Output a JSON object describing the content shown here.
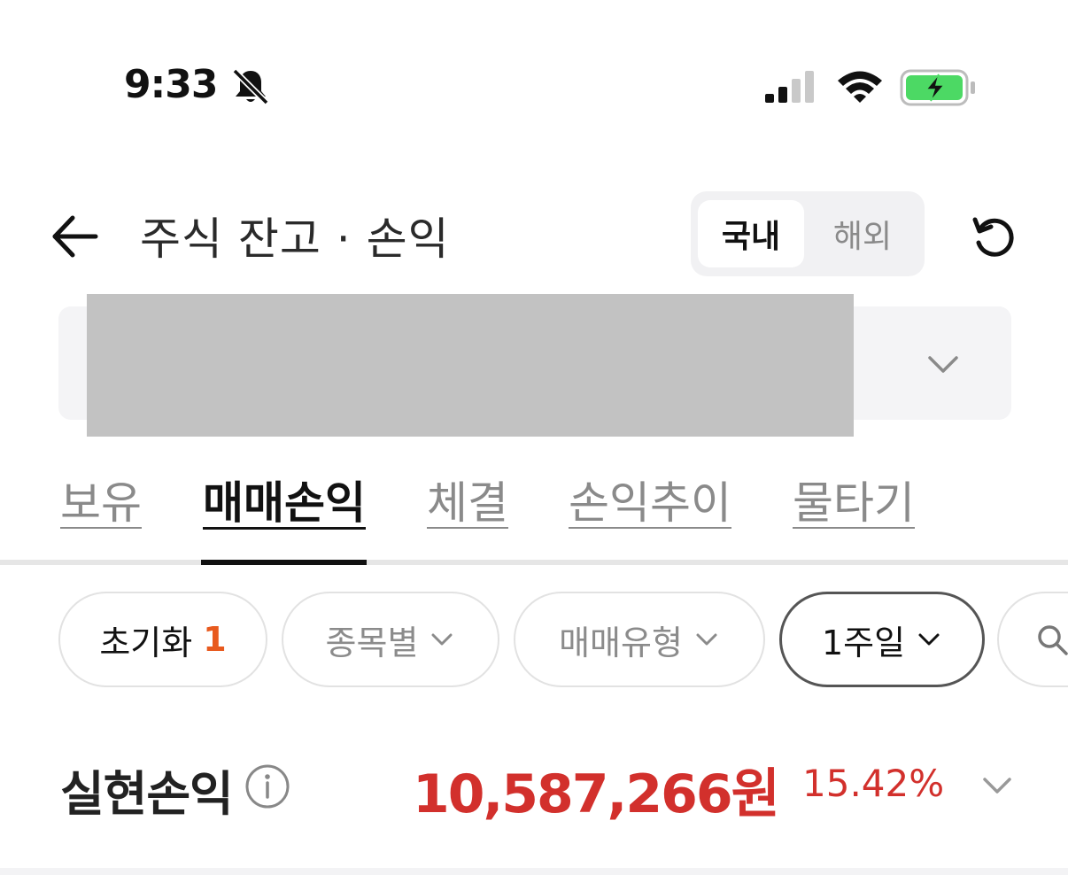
{
  "status_bar": {
    "time": "9:33",
    "icons": [
      "bell-slash-icon",
      "cellular-signal-icon",
      "wifi-icon",
      "battery-charging-icon"
    ],
    "battery_color": "#4cd964"
  },
  "header": {
    "title": "주식 잔고 · 손익",
    "segments": [
      "국내",
      "해외"
    ],
    "selected_segment": "국내"
  },
  "tabs": [
    {
      "label": "보유"
    },
    {
      "label": "매매손익"
    },
    {
      "label": "체결"
    },
    {
      "label": "손익추이"
    },
    {
      "label": "물타기"
    }
  ],
  "active_tab": "매매손익",
  "filters": {
    "reset_label": "초기화",
    "reset_count": "1",
    "by_stock": "종목별",
    "trade_type": "매매유형",
    "period": "1주일"
  },
  "summary": {
    "label": "실현손익",
    "amount": "10,587,266원",
    "rate": "15.42%",
    "profit_color": "#d2302c"
  },
  "colors": {
    "accent_orange": "#e85a1e",
    "profit_red": "#d2302c"
  }
}
